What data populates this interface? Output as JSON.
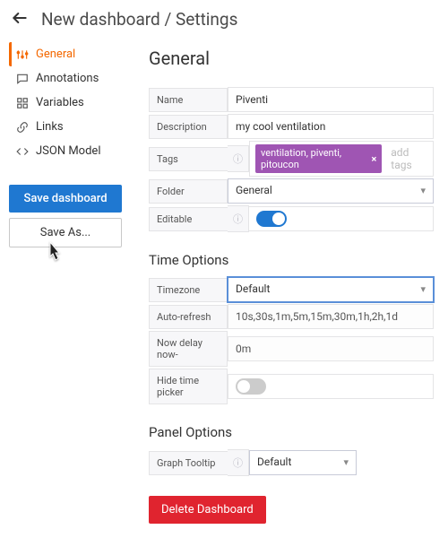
{
  "breadcrumb": "New dashboard / Settings",
  "nav": {
    "general": "General",
    "annotations": "Annotations",
    "variables": "Variables",
    "links": "Links",
    "json": "JSON Model"
  },
  "buttons": {
    "save": "Save dashboard",
    "saveas": "Save As...",
    "delete": "Delete Dashboard"
  },
  "sections": {
    "general": "General",
    "time": "Time Options",
    "panel": "Panel Options"
  },
  "fields": {
    "name": {
      "label": "Name",
      "value": "Piventi"
    },
    "description": {
      "label": "Description",
      "value": "my cool ventilation"
    },
    "tags": {
      "label": "Tags",
      "value": "ventilation, piventi, pitoucon",
      "placeholder": "add tags"
    },
    "folder": {
      "label": "Folder",
      "value": "General"
    },
    "editable": {
      "label": "Editable"
    },
    "timezone": {
      "label": "Timezone",
      "value": "Default"
    },
    "autorefresh": {
      "label": "Auto-refresh",
      "value": "10s,30s,1m,5m,15m,30m,1h,2h,1d"
    },
    "nowdelay": {
      "label": "Now delay now-",
      "value": "0m"
    },
    "hidetimepicker": {
      "label": "Hide time picker"
    },
    "graphtooltip": {
      "label": "Graph Tooltip",
      "value": "Default"
    }
  }
}
